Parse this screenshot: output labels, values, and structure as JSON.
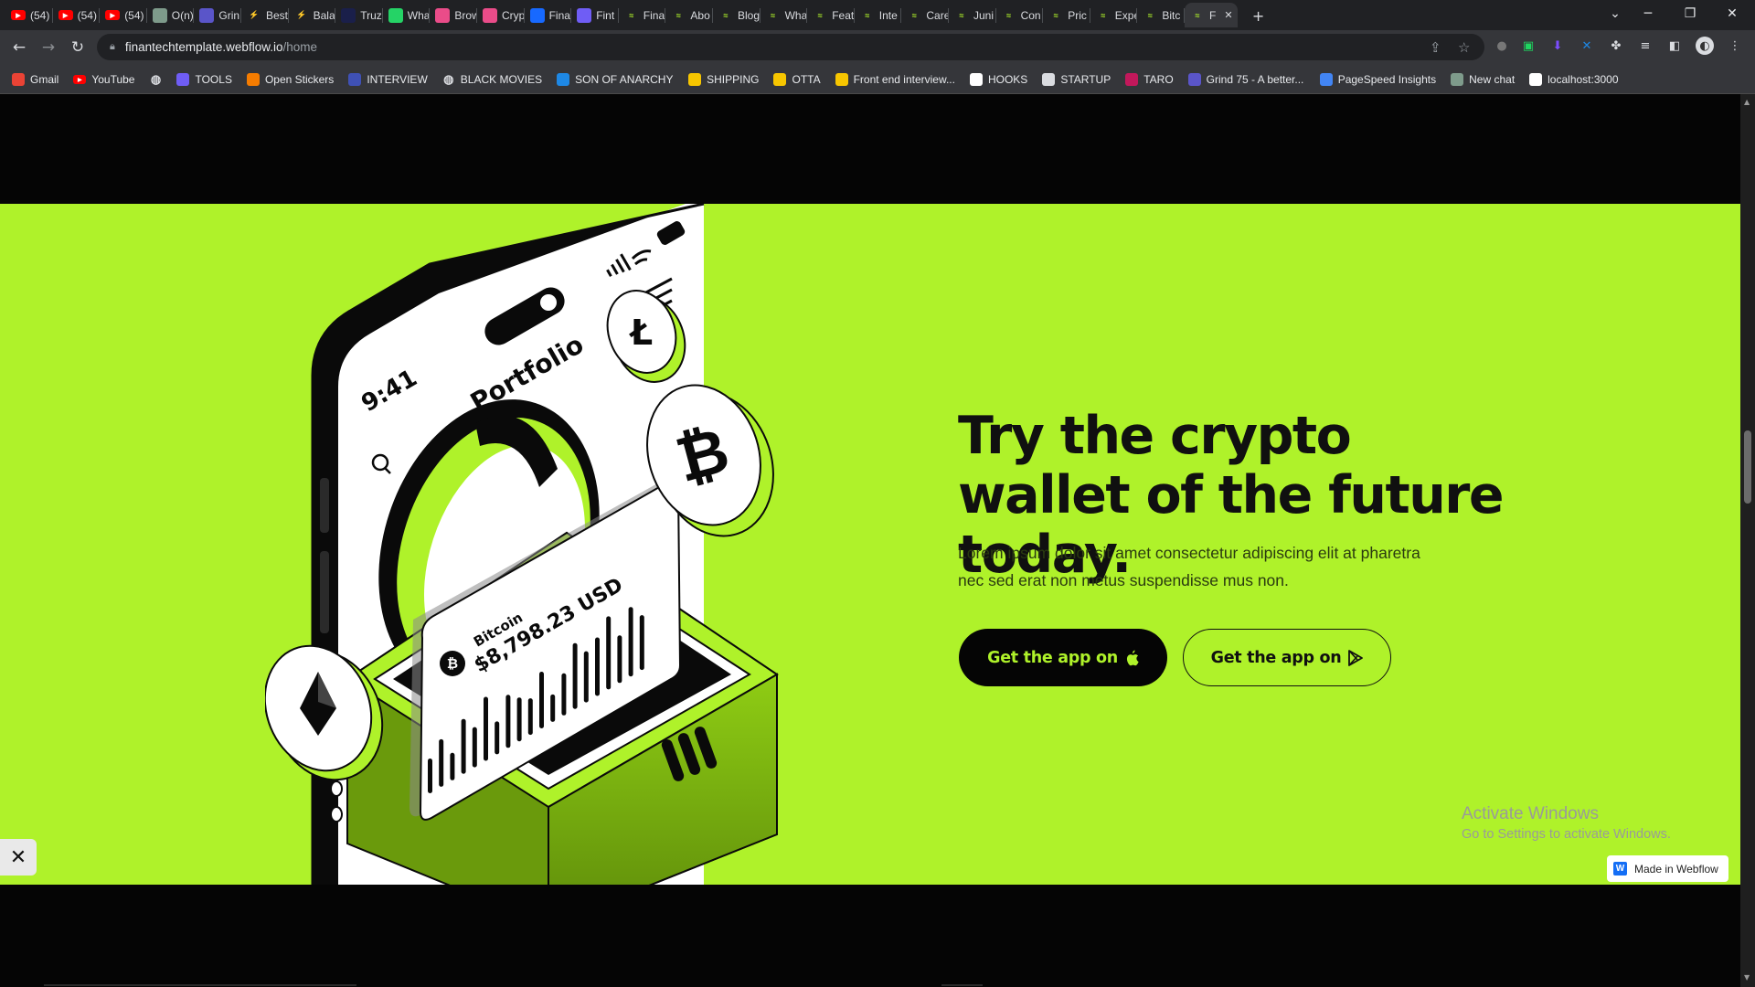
{
  "browser": {
    "tabs": [
      {
        "label": "(54)",
        "icon": "youtube-icon",
        "color": "#ff0000"
      },
      {
        "label": "(54)",
        "icon": "youtube-icon",
        "color": "#ff0000"
      },
      {
        "label": "(54)",
        "icon": "youtube-icon",
        "color": "#ff0000"
      },
      {
        "label": "O(n)",
        "icon": "openai-icon",
        "color": "#7e9b8b"
      },
      {
        "label": "Grin",
        "icon": "grind75-icon",
        "color": "#5a55c9"
      },
      {
        "label": "Best",
        "icon": "bolt-icon",
        "color": "#f7a600"
      },
      {
        "label": "Bala",
        "icon": "bolt-icon",
        "color": "#f7a600"
      },
      {
        "label": "Truz",
        "icon": "truz-icon",
        "color": "#1a1f4a"
      },
      {
        "label": "Wha",
        "icon": "whatsapp-icon",
        "color": "#25d366"
      },
      {
        "label": "Brow",
        "icon": "dribbble-icon",
        "color": "#ea4c89"
      },
      {
        "label": "Cryp",
        "icon": "dribbble-icon",
        "color": "#ea4c89"
      },
      {
        "label": "Fina",
        "icon": "behance-icon",
        "color": "#1769ff"
      },
      {
        "label": "Fint",
        "icon": "dots-icon",
        "color": "#6f5df5"
      },
      {
        "label": "Fina",
        "icon": "finantech-icon",
        "color": "#aff22a"
      },
      {
        "label": "Abo",
        "icon": "finantech-icon",
        "color": "#aff22a"
      },
      {
        "label": "Blog",
        "icon": "finantech-icon",
        "color": "#aff22a"
      },
      {
        "label": "Wha",
        "icon": "finantech-icon",
        "color": "#aff22a"
      },
      {
        "label": "Feat",
        "icon": "finantech-icon",
        "color": "#aff22a"
      },
      {
        "label": "Inte",
        "icon": "finantech-icon",
        "color": "#aff22a"
      },
      {
        "label": "Care",
        "icon": "finantech-icon",
        "color": "#aff22a"
      },
      {
        "label": "Juni",
        "icon": "finantech-icon",
        "color": "#aff22a"
      },
      {
        "label": "Con",
        "icon": "finantech-icon",
        "color": "#aff22a"
      },
      {
        "label": "Pric",
        "icon": "finantech-icon",
        "color": "#aff22a"
      },
      {
        "label": "Expe",
        "icon": "finantech-icon",
        "color": "#aff22a"
      },
      {
        "label": "Bitc",
        "icon": "finantech-icon",
        "color": "#aff22a"
      },
      {
        "label": "F",
        "icon": "finantech-icon",
        "color": "#aff22a",
        "active": true
      }
    ],
    "new_tab_glyph": "+",
    "url_host": "finantechtemplate.webflow.io",
    "url_path": "/home",
    "bookmarks": [
      {
        "label": "Gmail",
        "icon": "gmail-icon",
        "color": "#ea4335"
      },
      {
        "label": "YouTube",
        "icon": "youtube-icon",
        "color": "#ff0000"
      },
      {
        "label": "",
        "icon": "globe-icon",
        "color": "#dadce0"
      },
      {
        "label": "TOOLS",
        "icon": "tools-icon",
        "color": "#6f5df5"
      },
      {
        "label": "Open Stickers",
        "icon": "stickers-icon",
        "color": "#f57c00"
      },
      {
        "label": "INTERVIEW",
        "icon": "interview-icon",
        "color": "#3f51b5"
      },
      {
        "label": "BLACK MOVIES",
        "icon": "globe-icon",
        "color": "#dadce0"
      },
      {
        "label": "SON OF ANARCHY",
        "icon": "flag-icon",
        "color": "#1e88e5"
      },
      {
        "label": "SHIPPING",
        "icon": "chevrons-icon",
        "color": "#f7c600"
      },
      {
        "label": "OTTA",
        "icon": "otta-icon",
        "color": "#f7c600"
      },
      {
        "label": "Front end interview...",
        "icon": "bookmark-icon",
        "color": "#f7c600"
      },
      {
        "label": "HOOKS",
        "icon": "ui-icon",
        "color": "#ffffff"
      },
      {
        "label": "STARTUP",
        "icon": "lines-icon",
        "color": "#dadce0"
      },
      {
        "label": "TARO",
        "icon": "taro-icon",
        "color": "#c2185b"
      },
      {
        "label": "Grind 75 - A better...",
        "icon": "grind75-icon",
        "color": "#5a55c9"
      },
      {
        "label": "PageSpeed Insights",
        "icon": "pagespeed-icon",
        "color": "#4285f4"
      },
      {
        "label": "New chat",
        "icon": "openai-icon",
        "color": "#7e9b8b"
      },
      {
        "label": "localhost:3000",
        "icon": "triangle-icon",
        "color": "#ffffff"
      }
    ]
  },
  "hero": {
    "headline": "Try the crypto wallet of the future today.",
    "description": "Lorem ipsum dolor sit amet consectetur adipiscing elit at pharetra nec sed erat non metus suspendisse mus non.",
    "cta_apple_label": "Get the app on",
    "cta_play_label": "Get the app on",
    "accent_color": "#aff22a",
    "illustration": {
      "phone_time": "9:41",
      "phone_title": "Portfolio",
      "card_coin": "Bitcoin",
      "card_price": "$8,798.23 USD",
      "coins": [
        "litecoin-icon",
        "bitcoin-icon",
        "ethereum-icon"
      ]
    }
  },
  "overlay": {
    "activate_title": "Activate Windows",
    "activate_sub": "Go to Settings to activate Windows.",
    "webflow_badge": "Made in Webflow",
    "webflow_glyph": "W"
  }
}
